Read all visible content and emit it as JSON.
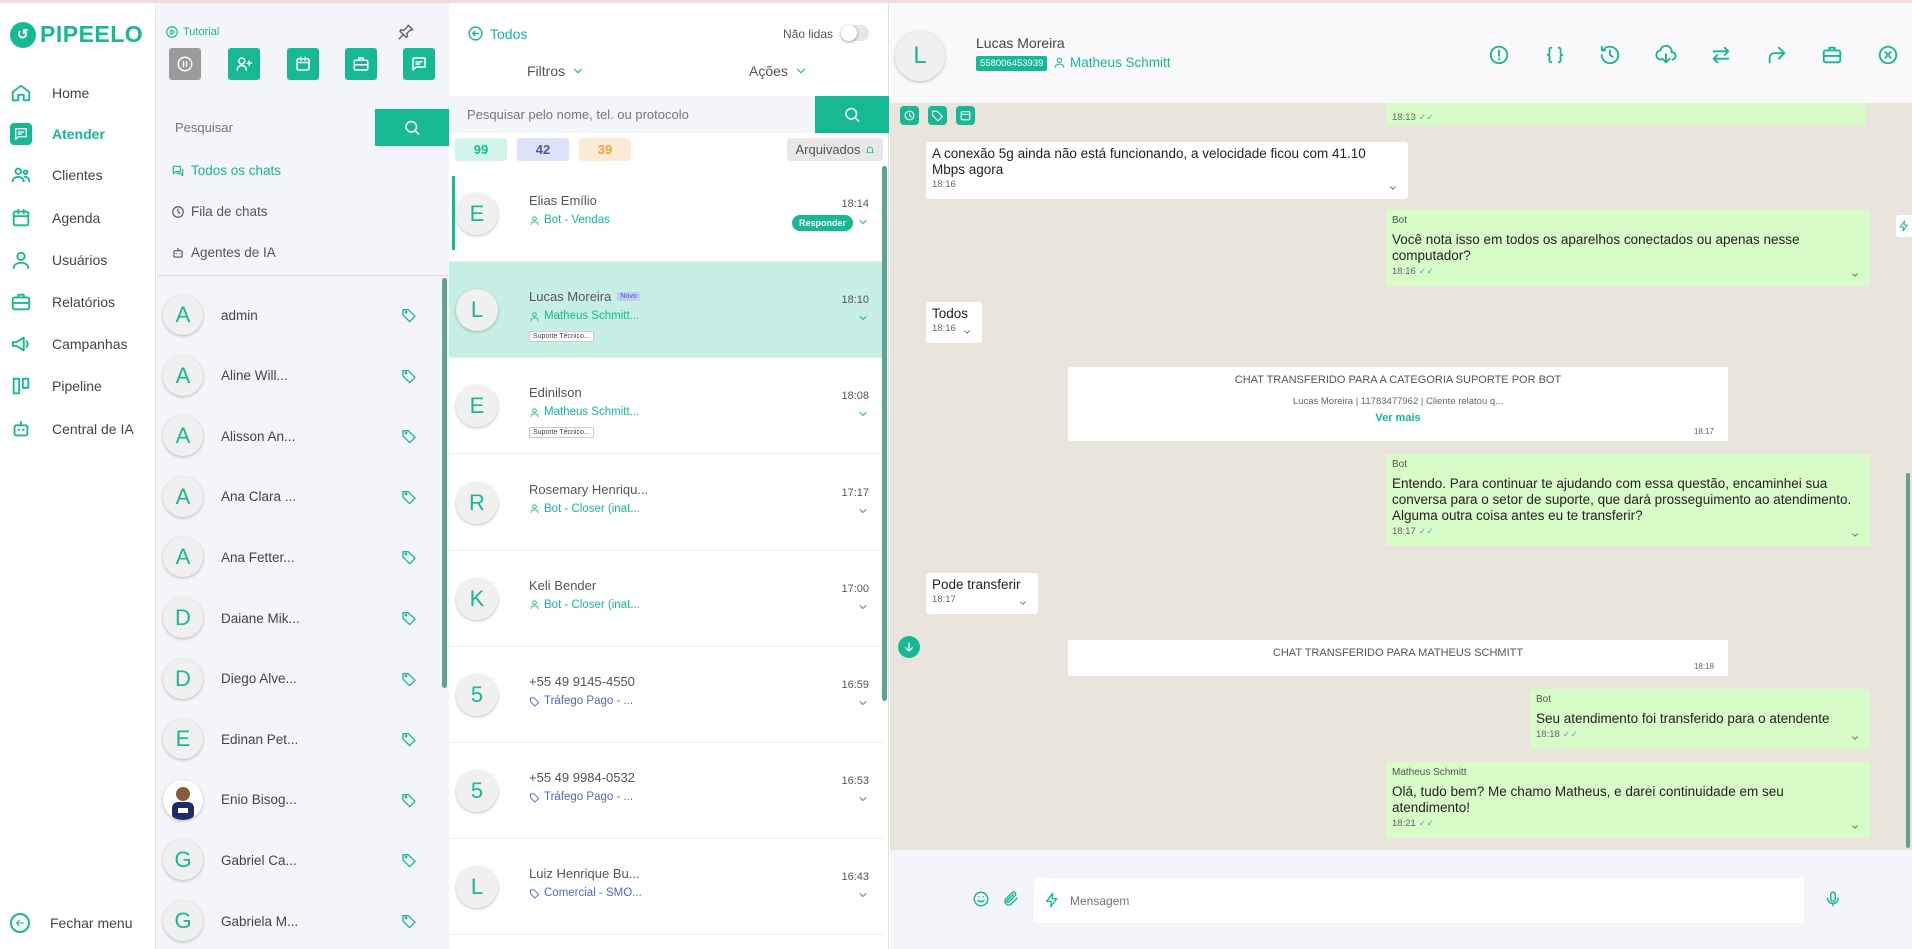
{
  "brand": {
    "name": "PIPEELO",
    "color": "#17b894"
  },
  "nav": {
    "items": [
      {
        "label": "Home",
        "icon": "home-icon"
      },
      {
        "label": "Atender",
        "icon": "chat-icon",
        "active": true
      },
      {
        "label": "Clientes",
        "icon": "users-icon"
      },
      {
        "label": "Agenda",
        "icon": "calendar-icon"
      },
      {
        "label": "Usuários",
        "icon": "user-icon"
      },
      {
        "label": "Relatórios",
        "icon": "briefcase-icon"
      },
      {
        "label": "Campanhas",
        "icon": "megaphone-icon"
      },
      {
        "label": "Pipeline",
        "icon": "kanban-icon"
      },
      {
        "label": "Central de IA",
        "icon": "robot-icon"
      }
    ],
    "close_label": "Fechar menu"
  },
  "sidebar": {
    "tutorial_label": "Tutorial",
    "search_placeholder": "Pesquisar",
    "filters": [
      {
        "label": "Todos os chats",
        "active": true
      },
      {
        "label": "Fila de chats"
      },
      {
        "label": "Agentes de IA"
      }
    ],
    "agents": [
      {
        "initial": "A",
        "name": "admin"
      },
      {
        "initial": "A",
        "name": "Aline Will..."
      },
      {
        "initial": "A",
        "name": "Alisson An..."
      },
      {
        "initial": "A",
        "name": "Ana Clara ..."
      },
      {
        "initial": "A",
        "name": "Ana Fetter..."
      },
      {
        "initial": "D",
        "name": "Daiane Mik..."
      },
      {
        "initial": "D",
        "name": "Diego Alve..."
      },
      {
        "initial": "E",
        "name": "Edinan Pet..."
      },
      {
        "initial": "",
        "name": "Enio Bisog...",
        "photo": true
      },
      {
        "initial": "G",
        "name": "Gabriel Ca..."
      },
      {
        "initial": "G",
        "name": "Gabriela M..."
      }
    ]
  },
  "chatlist": {
    "title": "Todos",
    "unread_label": "Não lidas",
    "filters_label": "Filtros",
    "actions_label": "Ações",
    "search_placeholder": "Pesquisar pelo nome, tel. ou protocolo",
    "counts": [
      {
        "value": "99",
        "bg": "#d3f4ea",
        "fg": "#17b894"
      },
      {
        "value": "42",
        "bg": "#dde2fa",
        "fg": "#4a58b3"
      },
      {
        "value": "39",
        "bg": "#fdecd5",
        "fg": "#e8a23f"
      }
    ],
    "archived_label": "Arquivados",
    "chats": [
      {
        "initial": "E",
        "name": "Elias Emílio",
        "sub": "Bot - Vendas",
        "time": "18:14",
        "reply": "Responder"
      },
      {
        "initial": "L",
        "name": "Lucas Moreira",
        "badge": "Novo",
        "sub": "Matheus Schmitt...",
        "time": "18:10",
        "label": "Suporte Técnico..."
      },
      {
        "initial": "E",
        "name": "Edinilson",
        "sub": "Matheus Schmitt...",
        "time": "18:08",
        "label": "Suporte Técnico..."
      },
      {
        "initial": "R",
        "name": "Rosemary Henriqu...",
        "sub": "Bot - Closer (inat...",
        "time": "17:17"
      },
      {
        "initial": "K",
        "name": "Keli Bender",
        "sub": "Bot - Closer (inat...",
        "time": "17:00"
      },
      {
        "initial": "5",
        "name": "+55 49 9145-4550",
        "sub": "Tráfego Pago - ...",
        "time": "16:59",
        "tag": true
      },
      {
        "initial": "5",
        "name": "+55 49 9984-0532",
        "sub": "Tráfego Pago - ...",
        "time": "16:53",
        "tag": true
      },
      {
        "initial": "L",
        "name": "Luiz Henrique Bu...",
        "sub": "Comercial - SMO...",
        "time": "16:43",
        "tag": true
      }
    ]
  },
  "conversation": {
    "initial": "L",
    "name": "Lucas Moreira",
    "phone": "558006453939",
    "agent": "Matheus Schmitt",
    "header_actions": [
      "alert-icon",
      "variables-icon",
      "history-icon",
      "download-cloud-icon",
      "transfer-icon",
      "forward-icon",
      "briefcase-icon",
      "close-icon"
    ],
    "top_time": "18:13",
    "messages": [
      {
        "kind": "in",
        "text": "A conexão 5g ainda não está funcionando, a velocidade ficou com 41.10 Mbps agora",
        "time": "18:16"
      },
      {
        "kind": "out",
        "who": "Bot",
        "text": "Você nota isso em todos os aparelhos conectados ou apenas nesse computador?",
        "time": "18:16"
      },
      {
        "kind": "in",
        "text": "Todos",
        "time": "18:16"
      },
      {
        "kind": "sys",
        "title": "CHAT TRANSFERIDO PARA A CATEGORIA SUPORTE POR BOT",
        "detail": "Lucas Moreira | 11783477962 | Cliente relatou q...",
        "more": "Ver mais",
        "time": "18:17"
      },
      {
        "kind": "out",
        "who": "Bot",
        "text": "Entendo. Para continuar te ajudando com essa questão, encaminhei sua conversa para o setor de suporte, que dará prosseguimento ao atendimento.\nAlguma outra coisa antes eu te transferir?",
        "time": "18:17"
      },
      {
        "kind": "in",
        "text": "Pode transferir",
        "time": "18:17"
      },
      {
        "kind": "sys",
        "title": "CHAT TRANSFERIDO PARA MATHEUS SCHMITT",
        "time": "18:18"
      },
      {
        "kind": "out",
        "who": "Bot",
        "text": "Seu atendimento foi transferido para o atendente",
        "time": "18:18"
      },
      {
        "kind": "out",
        "who": "Matheus Schmitt",
        "text": "Olá, tudo bem? Me chamo Matheus, e darei continuidade em seu atendimento!",
        "time": "18:21"
      }
    ],
    "composer_placeholder": "Mensagem"
  }
}
